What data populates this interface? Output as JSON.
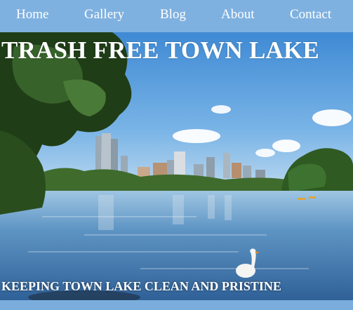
{
  "nav": {
    "items": [
      {
        "label": "Home"
      },
      {
        "label": "Gallery"
      },
      {
        "label": "Blog"
      },
      {
        "label": "About"
      },
      {
        "label": "Contact"
      }
    ]
  },
  "hero": {
    "title": "TRASH FREE TOWN LAKE",
    "subtitle": "KEEPING TOWN LAKE CLEAN AND PRISTINE"
  },
  "colors": {
    "nav_background": "#7fb1e0",
    "page_background": "#7aaddc",
    "text": "#ffffff"
  }
}
